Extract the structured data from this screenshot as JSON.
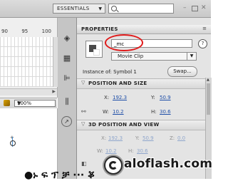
{
  "topbar": {
    "workspace_label": "ESSENTIALS",
    "search_value": "",
    "window_controls": [
      "minimize",
      "maximize",
      "close"
    ]
  },
  "timeline": {
    "ruler_labels": [
      "90",
      "95",
      "100"
    ]
  },
  "stagebar": {
    "zoom_value": "100%"
  },
  "properties": {
    "title": "PROPERTIES",
    "instance_name": "_mc",
    "symbol_type": "Movie Clip",
    "instance_of_label": "Instance of:",
    "instance_of_value": "Symbol 1",
    "swap_label": "Swap...",
    "position_size": {
      "header": "POSITION AND SIZE",
      "x_label": "X:",
      "x_value": "192.3",
      "y_label": "Y:",
      "y_value": "50.9",
      "w_label": "W:",
      "w_value": "10.2",
      "h_label": "H:",
      "h_value": "30.6"
    },
    "position_view_3d": {
      "header": "3D POSITION AND VIEW",
      "x_label": "X:",
      "x_value": "192.3",
      "y_label": "Y:",
      "y_value": "50.9",
      "z_label": "Z:",
      "z_value": "0.0",
      "w_label": "W:",
      "w_value": "10.2",
      "h_label": "H:",
      "h_value": "30.6"
    }
  },
  "watermark": {
    "text": "aloflash.com",
    "garbled_text": "●ኑ ፍ ፕ ቻ ··· ቖ"
  },
  "colors": {
    "highlight_ring": "#e01a1a",
    "value_link": "#1f4fa8",
    "panel_bg": "#e4e4e4"
  }
}
